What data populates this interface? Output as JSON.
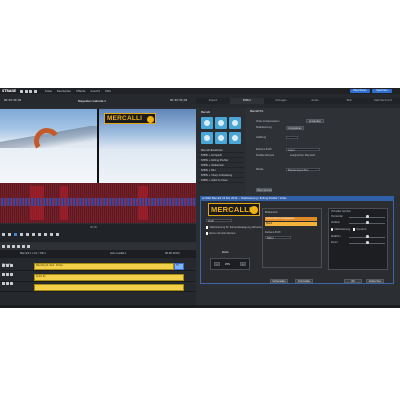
{
  "app": {
    "brand": "STRAGE",
    "menu": [
      "Datei",
      "Bearbeiten",
      "Effekte",
      "Ansicht",
      "Hilfe"
    ],
    "top_right_buttons": [
      {
        "label": "Exportieren",
        "color": "#2f6fcf"
      },
      {
        "label": "Speichern",
        "color": "#2f6fcf"
      }
    ]
  },
  "header": {
    "left_timecode": "00:00:00;00",
    "center_title": "Magostan Gebiete ▾",
    "right_timecode": "00:00:00;00"
  },
  "player": {
    "logo_text": "MERCALLI",
    "controls_time": "00:00"
  },
  "timeline": {
    "ruler_left": "Mercalli 1 ▾ Kn / TIN 1",
    "ruler_mid": "Auto Ausfall ▾",
    "ruler_right": "00:00:16;00",
    "tracks": [
      {
        "label": "Mercalli",
        "clips": [
          {
            "text": "Mercalli_01.mp4 · 25 fps",
            "kind": "yellow"
          },
          {
            "text": "FX",
            "kind": "blue"
          }
        ]
      },
      {
        "label": "",
        "clips": [
          {
            "text": "Audio 01",
            "kind": "yellow"
          }
        ]
      },
      {
        "label": "",
        "clips": [
          {
            "text": "",
            "kind": "yellow"
          }
        ]
      }
    ]
  },
  "panel_tabs": [
    "Import",
    "Editor",
    "Vorlagen",
    "Audio",
    "Text",
    "Mehrfach-Cut"
  ],
  "active_tab": 1,
  "effects_panel": {
    "header": "Mercalli",
    "tiles": [
      "Mercalli",
      "Stabil",
      "Rolling",
      "Weitw.",
      "Optik",
      "Farbe"
    ],
    "list": [
      "Mercalli Basisfarbe",
      "NHMS + Komplett",
      "NHMS + Rolling Shutter",
      "NHMS + Weitwinkel",
      "NHMS + Blur",
      "NHMS + Sharp Antialiasing",
      "NHMS + Optik to Clean"
    ]
  },
  "properties": {
    "title": "Mercalli Pro",
    "rows": [
      {
        "label": "Video kompensieren",
        "value": "Anwenden"
      },
      {
        "label": "Stabilisierung",
        "value": "Analysieren"
      },
      {
        "label": "Glättung",
        "value": ""
      },
      {
        "label": "Kamera-Profil",
        "value": "Gopro"
      },
      {
        "label": "Shutter-Kamera",
        "value": "Ausgleichen Standard"
      },
      {
        "label": "Stärke",
        "value": "Basisanalyse Plus"
      }
    ],
    "button": "Übernehmen"
  },
  "dialog": {
    "title": "proDAD Mercalli V4 SAL 2010 — Stabilisierung / Rolling Shutter / Video",
    "preview_logo": "MERCALLI",
    "preset": "Profil",
    "checkbox1": "Stabilisierung für Kamerabewegung aktivieren",
    "checkbox2": "Keine virtuelle Kamera",
    "center_label": "Zoom",
    "zoom_value": "25%",
    "box_label": "Bildbereich",
    "options": [
      "Automatisch analysieren",
      "Stark",
      "Kamera-Profil",
      "Mittel"
    ],
    "grid_title": "Virtueller Gimbal",
    "slider_labels": [
      "Horizontal",
      "Vertikal",
      "Rotation",
      "Zoom"
    ],
    "radio_label": "Stabilisierung",
    "checkbox3": "Dynamic",
    "footer_left": "Vorbereiten",
    "footer_mid": "Dramatize",
    "footer_ok": "OK",
    "footer_cancel": "Abbrechen"
  }
}
